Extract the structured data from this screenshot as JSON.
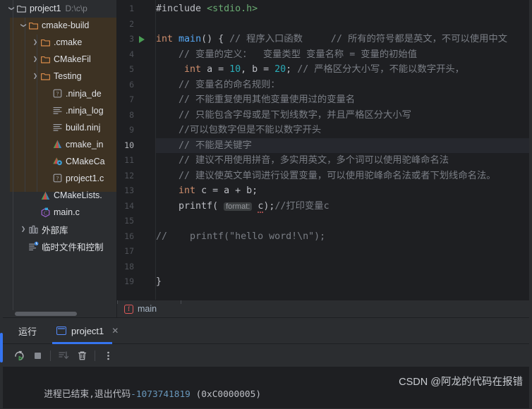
{
  "window": {
    "theme_bg": "#2b2d30",
    "editor_bg": "#1e1f22",
    "accent": "#3574f0",
    "selection_brown": "#3d3223"
  },
  "project_tree": {
    "items": [
      {
        "label": "project1",
        "path": "D:\\c\\p",
        "icon": "folder-icon",
        "arrow": "chevron-down",
        "indent": 0,
        "selected": false,
        "icon_color": "#b4b6bb"
      },
      {
        "label": "cmake-build",
        "path": "",
        "icon": "folder-orange-icon",
        "arrow": "chevron-down",
        "indent": 1,
        "selected": true,
        "icon_color": "#d98b4a"
      },
      {
        "label": ".cmake",
        "path": "",
        "icon": "folder-orange-icon",
        "arrow": "chevron-right",
        "indent": 2,
        "selected": true,
        "icon_color": "#d98b4a"
      },
      {
        "label": "CMakeFil",
        "path": "",
        "icon": "folder-orange-icon",
        "arrow": "chevron-right",
        "indent": 2,
        "selected": true,
        "icon_color": "#d98b4a"
      },
      {
        "label": "Testing",
        "path": "",
        "icon": "folder-orange-icon",
        "arrow": "chevron-right",
        "indent": 2,
        "selected": true,
        "icon_color": "#d98b4a"
      },
      {
        "label": ".ninja_de",
        "path": "",
        "icon": "unknown-file-icon",
        "arrow": "",
        "indent": 3,
        "selected": true,
        "icon_color": "#9da0a8"
      },
      {
        "label": ".ninja_log",
        "path": "",
        "icon": "text-file-icon",
        "arrow": "",
        "indent": 3,
        "selected": true,
        "icon_color": "#9da0a8"
      },
      {
        "label": "build.ninj",
        "path": "",
        "icon": "text-file-icon",
        "arrow": "",
        "indent": 3,
        "selected": true,
        "icon_color": "#9da0a8"
      },
      {
        "label": "cmake_in",
        "path": "",
        "icon": "cmake-file-icon",
        "arrow": "",
        "indent": 3,
        "selected": true,
        "icon_color": "#4f9e4f"
      },
      {
        "label": "CMakeCa",
        "path": "",
        "icon": "cmake-cache-icon",
        "arrow": "",
        "indent": 3,
        "selected": true,
        "icon_color": "#4f9e4f"
      },
      {
        "label": "project1.c",
        "path": "",
        "icon": "unknown-file-icon",
        "arrow": "",
        "indent": 3,
        "selected": true,
        "icon_color": "#9da0a8"
      },
      {
        "label": "CMakeLists.",
        "path": "",
        "icon": "cmake-file-icon",
        "arrow": "",
        "indent": 2,
        "selected": false,
        "icon_color": "#4f9e4f"
      },
      {
        "label": "main.c",
        "path": "",
        "icon": "c-file-icon",
        "arrow": "",
        "indent": 2,
        "selected": false,
        "icon_color": "#a165d6"
      },
      {
        "label": "外部库",
        "path": "",
        "icon": "library-icon",
        "arrow": "chevron-right",
        "indent": 1,
        "selected": false,
        "icon_color": "#9da0a8"
      },
      {
        "label": "临时文件和控制",
        "path": "",
        "icon": "scratches-icon",
        "arrow": "",
        "indent": 1,
        "selected": false,
        "icon_color": "#9da0a8"
      }
    ]
  },
  "editor": {
    "current_line": 10,
    "run_marker_line": 3,
    "line_numbers": [
      "1",
      "2",
      "3",
      "4",
      "5",
      "6",
      "7",
      "8",
      "9",
      "10",
      "11",
      "12",
      "13",
      "14",
      "15",
      "16",
      "17",
      "18",
      "19"
    ],
    "lines": [
      {
        "n": 1,
        "html": "<span class=\"pp\">#include</span> <span class=\"str\">&lt;stdio.h&gt;</span>"
      },
      {
        "n": 2,
        "html": ""
      },
      {
        "n": 3,
        "html": "<span class=\"kw\">int</span> <span class=\"fn\">main</span>() { <span class=\"cm\">// 程序入口函数     // 所有的符号都是英文，不可以使用中文</span>"
      },
      {
        "n": 4,
        "html": "    <span class=\"cm\">// 变量的定义：  变量类型 变量名称 = 变量的初始值</span>"
      },
      {
        "n": 5,
        "html": "     <span class=\"kw\">int</span> a = <span class=\"num\">10</span>, b = <span class=\"num\">20</span>; <span class=\"cm\">// 严格区分大小写，不能以数字开头，</span>"
      },
      {
        "n": 6,
        "html": "    <span class=\"cm\">// 变量名的命名规则：</span>"
      },
      {
        "n": 7,
        "html": "    <span class=\"cm\">// 不能重复使用其他变量使用过的变量名</span>"
      },
      {
        "n": 8,
        "html": "    <span class=\"cm\">// 只能包含字母或是下划线数字，并且严格区分大小写</span>"
      },
      {
        "n": 9,
        "html": "    <span class=\"cm\">//可以包数字但是不能以数字开头</span>"
      },
      {
        "n": 10,
        "html": "    <span class=\"cm\">// 不能是关键字</span>"
      },
      {
        "n": 11,
        "html": "    <span class=\"cm\">// 建议不用使用拼音，多实用英文，多个词可以使用驼峰命名法</span>"
      },
      {
        "n": 12,
        "html": "    <span class=\"cm\">// 建议使英文单词进行设置变量，可以使用驼峰命名法或者下划线命名法。</span>"
      },
      {
        "n": 13,
        "html": "    <span class=\"kw\">int</span> c = a + b;"
      },
      {
        "n": 14,
        "html": "    <span class=\"df\">printf</span>( <span class=\"hint\">format:</span> <span class=\"squig\">c</span>);<span class=\"cm\">//打印变量c</span>"
      },
      {
        "n": 15,
        "html": ""
      },
      {
        "n": 16,
        "html": "<span class=\"cm\">//    printf(\"hello word!\\n\");</span>"
      },
      {
        "n": 17,
        "html": ""
      },
      {
        "n": 18,
        "html": ""
      },
      {
        "n": 19,
        "html": "}"
      }
    ],
    "plain_lines": [
      "#include <stdio.h>",
      "",
      "int main() { // 程序入口函数     // 所有的符号都是英文，不可以使用中文",
      "    // 变量的定义：  变量类型 变量名称 = 变量的初始值",
      "     int a = 10, b = 20; // 严格区分大小写，不能以数字开头，",
      "    // 变量名的命名规则：",
      "    // 不能重复使用其他变量使用过的变量名",
      "    // 只能包含字母或是下划线数字，并且严格区分大小写",
      "    //可以包数字但是不能以数字开头",
      "    // 不能是关键字",
      "    // 建议不用使用拼音，多实用英文，多个词可以使用驼峰命名法",
      "    // 建议使英文单词进行设置变量，可以使用驼峰命名法或者下划线命名法。",
      "    int c = a + b;",
      "    printf( format: c);//打印变量c",
      "",
      "//    printf(\"hello word!\\n\");",
      "",
      "",
      "}"
    ],
    "hint_label": "format:"
  },
  "breadcrumb": {
    "icon": "function-icon",
    "icon_letter": "f",
    "label": "main"
  },
  "run_panel": {
    "title": "运行",
    "tab_label": "project1",
    "tab_close": "✕",
    "toolbar": [
      {
        "name": "rerun-button",
        "glyph": "rerun-icon"
      },
      {
        "name": "stop-button",
        "glyph": "stop-icon"
      },
      {
        "name": "scroll-to-end-button",
        "glyph": "scroll-end-icon"
      },
      {
        "name": "clear-all-button",
        "glyph": "trash-icon"
      },
      {
        "name": "more-options-button",
        "glyph": "kebab-icon"
      }
    ],
    "console_prefix": "进程已结束,退出代码",
    "console_exit_code": "-1073741819",
    "console_suffix": " (0xC0000005)",
    "watermark": "CSDN @阿龙的代码在报错"
  }
}
